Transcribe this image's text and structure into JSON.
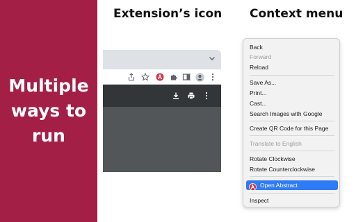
{
  "promo": {
    "lines": [
      "Multiple",
      "ways to",
      "run"
    ],
    "background": "#a41f46"
  },
  "headings": {
    "extension_icon": "Extension’s icon",
    "context_menu": "Context menu"
  },
  "browser": {
    "toolbar_icons": [
      "share-icon",
      "bookmark-star-icon",
      "abstract-extension-icon",
      "extensions-puzzle-icon",
      "side-panel-icon",
      "profile-avatar-icon",
      "more-vert-icon"
    ],
    "pdf_toolbar_icons": [
      "download-icon",
      "print-icon",
      "more-vert-icon"
    ],
    "colors": {
      "pdf_toolbar": "#323639",
      "viewport": "#525659",
      "accent": "#d93240"
    }
  },
  "context_menu": {
    "items": [
      {
        "label": "Back",
        "enabled": true
      },
      {
        "label": "Forward",
        "enabled": false
      },
      {
        "label": "Reload",
        "enabled": true
      },
      {
        "label": "Save As...",
        "enabled": true
      },
      {
        "label": "Print...",
        "enabled": true
      },
      {
        "label": "Cast...",
        "enabled": true
      },
      {
        "label": "Search Images with Google",
        "enabled": true
      },
      {
        "label": "Create QR Code for this Page",
        "enabled": true
      },
      {
        "label": "Translate to English",
        "enabled": false
      },
      {
        "label": "Rotate Clockwise",
        "enabled": true
      },
      {
        "label": "Rotate Counterclockwise",
        "enabled": true
      },
      {
        "label": "Open Abstract",
        "enabled": true,
        "highlighted": true
      },
      {
        "label": "Inspect",
        "enabled": true
      }
    ],
    "highlight_color": "#2f7bf5"
  }
}
